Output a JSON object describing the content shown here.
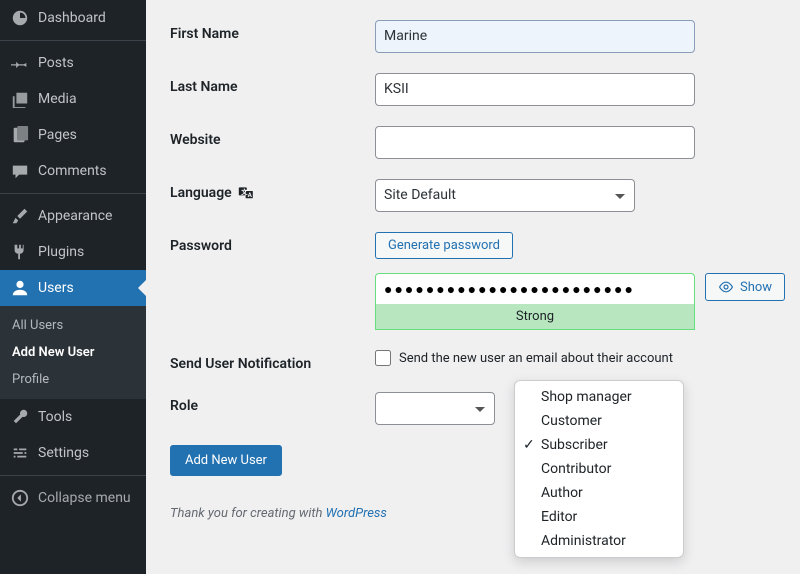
{
  "sidebar": {
    "items": [
      {
        "label": "Dashboard"
      },
      {
        "label": "Posts"
      },
      {
        "label": "Media"
      },
      {
        "label": "Pages"
      },
      {
        "label": "Comments"
      },
      {
        "label": "Appearance"
      },
      {
        "label": "Plugins"
      },
      {
        "label": "Users"
      },
      {
        "label": "Tools"
      },
      {
        "label": "Settings"
      },
      {
        "label": "Collapse menu"
      }
    ],
    "submenu": [
      {
        "label": "All Users"
      },
      {
        "label": "Add New User"
      },
      {
        "label": "Profile"
      }
    ]
  },
  "form": {
    "first_name_label": "First Name",
    "first_name_value": "Marine",
    "last_name_label": "Last Name",
    "last_name_value": "KSII",
    "website_label": "Website",
    "website_value": "",
    "language_label": "Language",
    "language_value": "Site Default",
    "password_label": "Password",
    "generate_password_label": "Generate password",
    "password_value": "●●●●●●●●●●●●●●●●●●●●●●●●",
    "password_strength": "Strong",
    "show_label": "Show",
    "notification_label": "Send User Notification",
    "notification_text": "Send the new user an email about their account",
    "role_label": "Role",
    "submit_label": "Add New User"
  },
  "role_dropdown": {
    "options": [
      "Shop manager",
      "Customer",
      "Subscriber",
      "Contributor",
      "Author",
      "Editor",
      "Administrator"
    ],
    "selected_index": 2
  },
  "footer": {
    "prefix": "Thank you for creating with ",
    "link": "WordPress"
  }
}
